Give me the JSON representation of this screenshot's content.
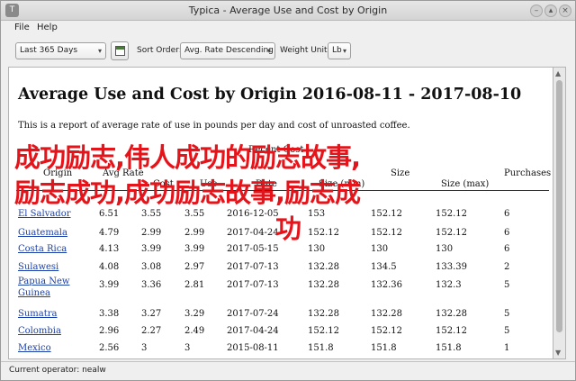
{
  "window": {
    "title": "Typica - Average Use and Cost by Origin",
    "icon_name": "app-icon",
    "controls": [
      "minimize-icon",
      "restore-icon",
      "close-icon"
    ]
  },
  "menu": {
    "file": "File",
    "help": "Help"
  },
  "toolbar": {
    "date_range": "Last 365 Days",
    "sort_label": "Sort Order:",
    "sort_value": "Avg. Rate Descending",
    "weight_label": "Weight Unit:",
    "weight_value": "Lb"
  },
  "report": {
    "title": "Average Use and Cost by Origin 2016-08-11 - 2017-08-10",
    "description": "This is a report of average rate of use in pounds per day and cost of unroasted coffee.",
    "headers": {
      "origin": "Origin",
      "avg_rate": "Avg Rate",
      "avg_cost": "Cost",
      "avg_use": "Use",
      "last_purchase_date": "Date",
      "recent_cost_group": "Recent Cost",
      "purchase_size": "Size (min)",
      "avg_size": "Size",
      "max_size": "Size (max)",
      "purchases": "Purchases"
    },
    "rows": [
      {
        "origin": "El Salvador",
        "c1": "6.51",
        "c2": "3.55",
        "c3": "3.55",
        "date": "2016-12-05",
        "c5": "153",
        "c6": "152.12",
        "c7": "152.12",
        "c8": "6"
      },
      {
        "origin": "Guatemala",
        "c1": "4.79",
        "c2": "2.99",
        "c3": "2.99",
        "date": "2017-04-24",
        "c5": "152.12",
        "c6": "152.12",
        "c7": "152.12",
        "c8": "6"
      },
      {
        "origin": "Costa Rica",
        "c1": "4.13",
        "c2": "3.99",
        "c3": "3.99",
        "date": "2017-05-15",
        "c5": "130",
        "c6": "130",
        "c7": "130",
        "c8": "6"
      },
      {
        "origin": "Sulawesi",
        "c1": "4.08",
        "c2": "3.08",
        "c3": "2.97",
        "date": "2017-07-13",
        "c5": "132.28",
        "c6": "134.5",
        "c7": "133.39",
        "c8": "2"
      },
      {
        "origin": "Papua New Guinea",
        "c1": "3.99",
        "c2": "3.36",
        "c3": "2.81",
        "date": "2017-07-13",
        "c5": "132.28",
        "c6": "132.36",
        "c7": "132.3",
        "c8": "5"
      },
      {
        "origin": "Sumatra",
        "c1": "3.38",
        "c2": "3.27",
        "c3": "3.29",
        "date": "2017-07-24",
        "c5": "132.28",
        "c6": "132.28",
        "c7": "132.28",
        "c8": "5"
      },
      {
        "origin": "Colombia",
        "c1": "2.96",
        "c2": "2.27",
        "c3": "2.49",
        "date": "2017-04-24",
        "c5": "152.12",
        "c6": "152.12",
        "c7": "152.12",
        "c8": "5"
      },
      {
        "origin": "Mexico",
        "c1": "2.56",
        "c2": "3",
        "c3": "3",
        "date": "2015-08-11",
        "c5": "151.8",
        "c6": "151.8",
        "c7": "151.8",
        "c8": "1"
      }
    ]
  },
  "overlay": {
    "line1": "成功励志,伟人成功的励志故事,",
    "line2": "励志成功,成功励志故事,励志成",
    "line3": "功",
    "color": "#e5141a"
  },
  "status": {
    "text": "Current operator: nealw"
  }
}
